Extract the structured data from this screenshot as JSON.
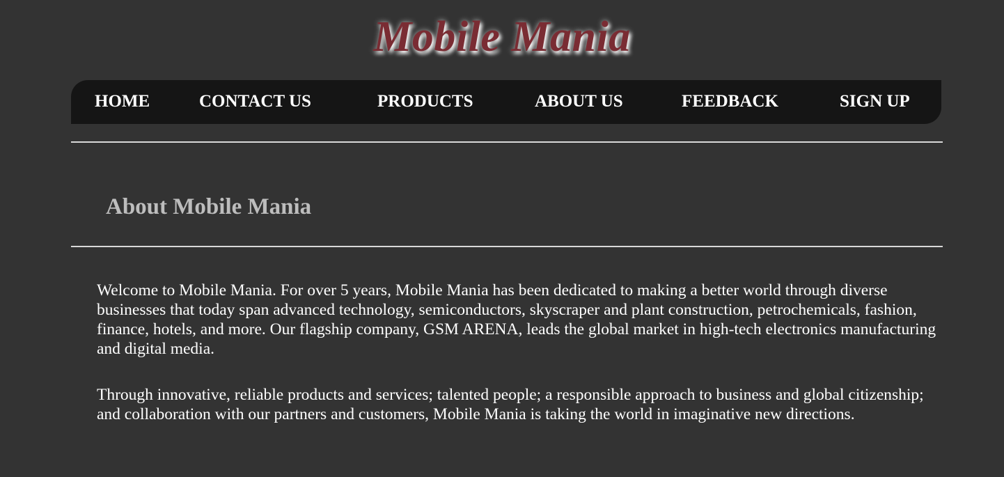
{
  "header": {
    "logo_text": "Mobile Mania",
    "logo_color": "#7a2c33"
  },
  "nav": {
    "items": [
      {
        "label": "HOME"
      },
      {
        "label": "CONTACT US"
      },
      {
        "label": "PRODUCTS"
      },
      {
        "label": "ABOUT US"
      },
      {
        "label": "FEEDBACK"
      },
      {
        "label": "SIGN UP"
      }
    ]
  },
  "main": {
    "title": "About Mobile Mania",
    "paragraphs": [
      "Welcome to Mobile Mania. For over 5 years, Mobile Mania has been dedicated to making a better world through diverse businesses that today span advanced technology, semiconductors, skyscraper and plant construction, petrochemicals, fashion, finance, hotels, and more. Our flagship company, GSM ARENA, leads the global market in high-tech electronics manufacturing and digital media.",
      "Through innovative, reliable products and services; talented people; a responsible approach to business and global citizenship; and collaboration with our partners and customers, Mobile Mania is taking the world in imaginative new directions."
    ]
  },
  "colors": {
    "background": "#333333",
    "navbar": "#151515",
    "title": "#bdbdbd",
    "text": "#ffffff"
  }
}
